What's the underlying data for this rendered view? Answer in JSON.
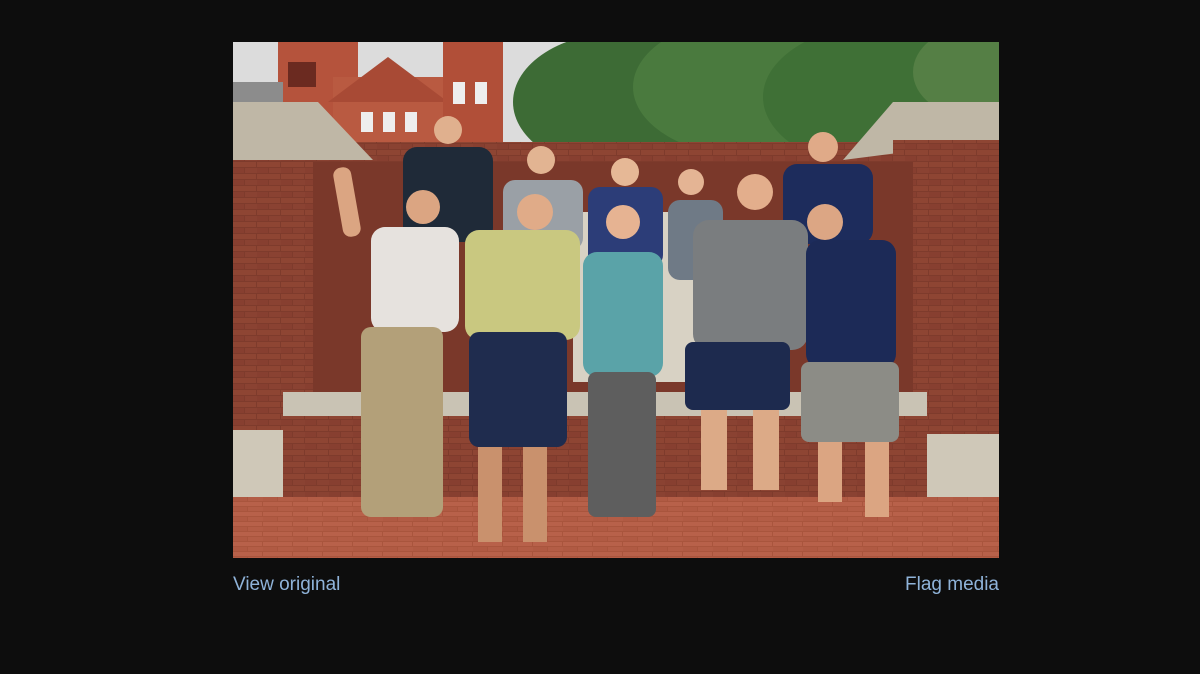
{
  "lightbox": {
    "view_original_label": "View original",
    "flag_media_label": "Flag media"
  },
  "colors": {
    "background": "#0d0d0d",
    "link": "#8fb3d9"
  }
}
